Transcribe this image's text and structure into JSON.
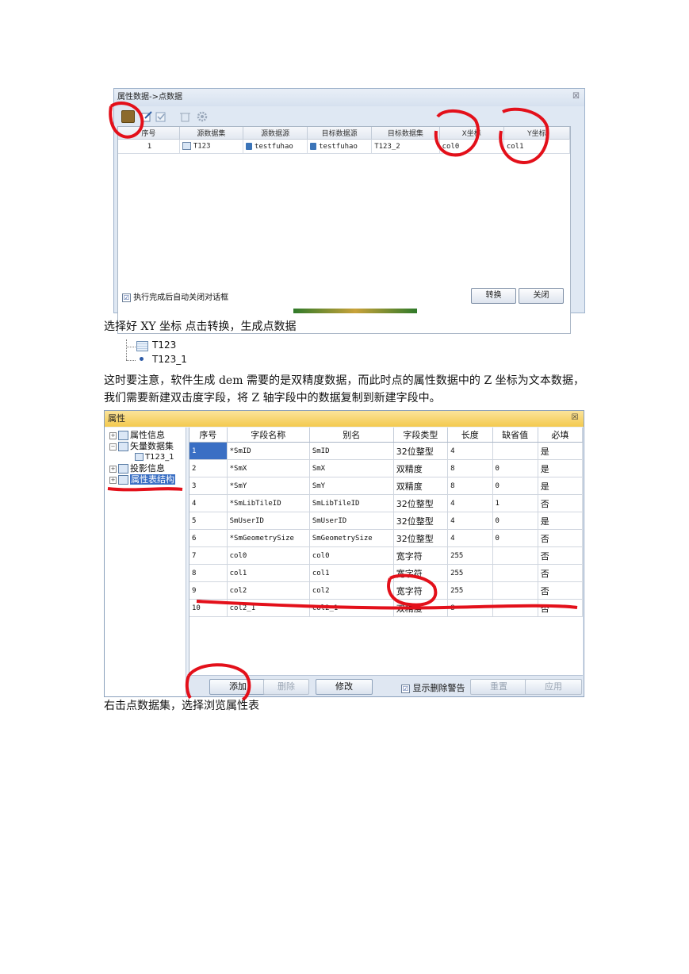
{
  "dialog1": {
    "title": "属性数据->点数据",
    "close_glyph": "☒",
    "columns": [
      "序号",
      "源数据集",
      "源数据源",
      "目标数据源",
      "目标数据集",
      "X坐标",
      "Y坐标"
    ],
    "row": [
      "1",
      "T123",
      "testfuhao",
      "testfuhao",
      "T123_2",
      "col0",
      "col1"
    ],
    "auto_close_label": "执行完成后自动关闭对话框",
    "auto_close_checked": "☑",
    "convert_button": "转换",
    "close_button": "关闭"
  },
  "paragraph1": "选择好 XY 坐标  点击转换，生成点数据",
  "tree_snippet": {
    "items": [
      "T123",
      "T123_1"
    ]
  },
  "paragraph2": "这时要注意，软件生成 dem 需要的是双精度数据，而此时点的属性数据中的 Z 坐标为文本数据，我们需要新建双击度字段，将 Z 轴字段中的数据复制到新建字段中。",
  "dialog2": {
    "title": "属性",
    "close_glyph": "☒",
    "tree": {
      "items": [
        "属性信息",
        "矢量数据集",
        "T123_1",
        "投影信息",
        "属性表结构"
      ]
    },
    "columns": [
      "序号",
      "字段名称",
      "别名",
      "字段类型",
      "长度",
      "缺省值",
      "必填"
    ],
    "rows": [
      [
        "1",
        "*SmID",
        "SmID",
        "32位整型",
        "4",
        "",
        "是"
      ],
      [
        "2",
        "*SmX",
        "SmX",
        "双精度",
        "8",
        "0",
        "是"
      ],
      [
        "3",
        "*SmY",
        "SmY",
        "双精度",
        "8",
        "0",
        "是"
      ],
      [
        "4",
        "*SmLibTileID",
        "SmLibTileID",
        "32位整型",
        "4",
        "1",
        "否"
      ],
      [
        "5",
        "SmUserID",
        "SmUserID",
        "32位整型",
        "4",
        "0",
        "是"
      ],
      [
        "6",
        "*SmGeometrySize",
        "SmGeometrySize",
        "32位整型",
        "4",
        "0",
        "否"
      ],
      [
        "7",
        "col0",
        "col0",
        "宽字符",
        "255",
        "",
        "否"
      ],
      [
        "8",
        "col1",
        "col1",
        "宽字符",
        "255",
        "",
        "否"
      ],
      [
        "9",
        "col2",
        "col2",
        "宽字符",
        "255",
        "",
        "否"
      ],
      [
        "10",
        "col2_1",
        "col2_1",
        "双精度",
        "8",
        "",
        "否"
      ]
    ],
    "buttons": {
      "add": "添加",
      "delete": "删除",
      "modify": "修改",
      "show_warning": "显示删除警告",
      "show_warning_checked": "☑",
      "reset": "重置",
      "apply": "应用"
    }
  },
  "paragraph3": "右击点数据集，选择浏览属性表",
  "colors": {
    "annotation_red": "#e3101a",
    "selection_blue": "#3a6fc4",
    "title_gold": "#f3c94e"
  }
}
